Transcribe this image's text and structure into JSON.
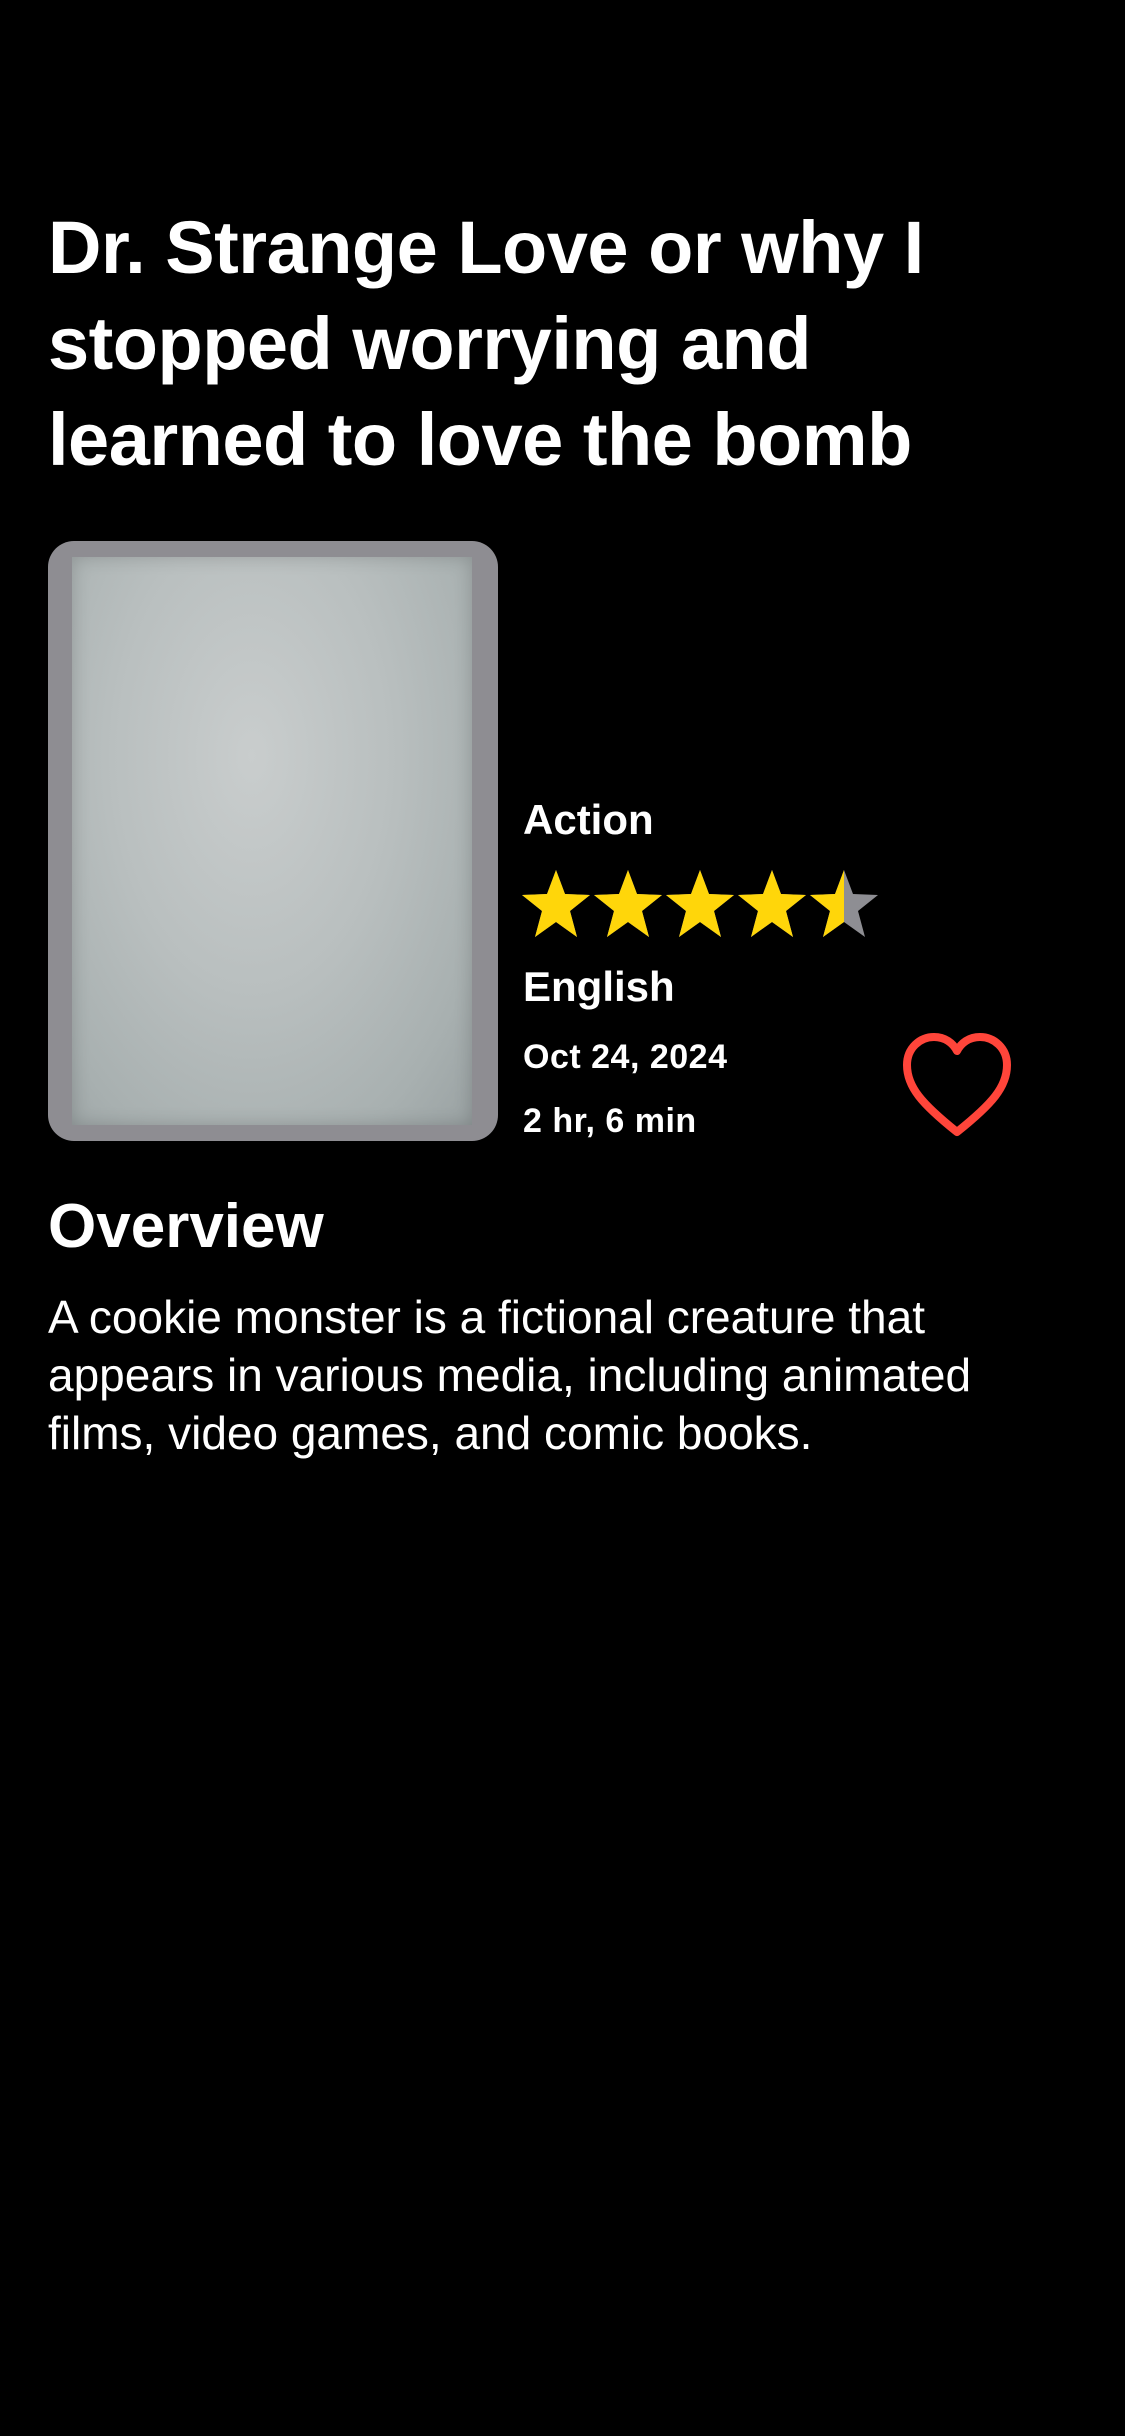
{
  "movie": {
    "title": "Dr. Strange Love or why I stopped worrying and learned to love the bomb",
    "genre": "Action",
    "rating": {
      "value": 4.5,
      "max": 5,
      "filled_color": "#FFD60A",
      "empty_color": "#8E8E93"
    },
    "language": "English",
    "release_date": "Oct 24, 2024",
    "duration": "2 hr, 6 min",
    "favorite": {
      "icon": "heart-outline-icon",
      "color": "#FF453A",
      "selected": false
    }
  },
  "overview": {
    "heading": "Overview",
    "text": "A cookie monster is a fictional creature that appears in various media, including animated films, video games, and comic books."
  },
  "colors": {
    "background": "#000000",
    "text": "#FFFFFF",
    "poster_frame": "#8E8D92"
  }
}
